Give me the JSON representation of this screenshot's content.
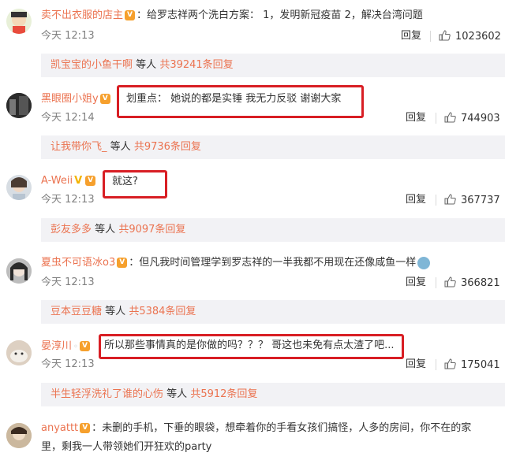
{
  "comments": [
    {
      "user": "卖不出衣服的店主",
      "text": "给罗志祥两个洗白方案：  1，发明新冠疫苗 2，解决台湾问题",
      "time": "今天 12:13",
      "reply": "回复",
      "likes": "1023602",
      "sub_user": "凯宝宝的小鱼干啊",
      "sub_mid": "等人",
      "sub_count": "共39241条回复"
    },
    {
      "user": "黑眼圈小姐y",
      "text": "划重点： 她说的都是实锤 我无力反驳 谢谢大家",
      "time": "今天 12:14",
      "reply": "回复",
      "likes": "744903",
      "sub_user": "让我带你飞_",
      "sub_mid": "等人",
      "sub_count": "共9736条回复"
    },
    {
      "user": "A-Weii",
      "text": "就这?",
      "time": "今天 12:13",
      "reply": "回复",
      "likes": "367737",
      "sub_user": "彭友多多",
      "sub_mid": "等人",
      "sub_count": "共9097条回复"
    },
    {
      "user": "夏虫不可语冰o3",
      "text": "但凡我时间管理学到罗志祥的一半我都不用现在还像咸鱼一样",
      "time": "今天 12:13",
      "reply": "回复",
      "likes": "366821",
      "sub_user": "豆本豆豆糖",
      "sub_mid": "等人",
      "sub_count": "共5384条回复"
    },
    {
      "user": "晏淳川",
      "text": "所以那些事情真的是你做的吗？？？ 哥这也未免有点太渣了吧...",
      "time": "今天 12:13",
      "reply": "回复",
      "likes": "175041",
      "sub_user": "半生轻浮洗礼了谁的心伤",
      "sub_mid": "等人",
      "sub_count": "共5912条回复"
    },
    {
      "user": "anyattt",
      "text_line1": "未删的手机，下垂的眼袋，想牵着你的手看女孩们搞怪，人多的房间，你不在的家",
      "text_line2": "里，剩我一人带领她们开狂欢的party"
    }
  ],
  "colors": {
    "username": "#eb7350",
    "highlight_box": "#d81e24",
    "badge": "#f6a02d",
    "sub_bg": "#f2f2f5"
  }
}
